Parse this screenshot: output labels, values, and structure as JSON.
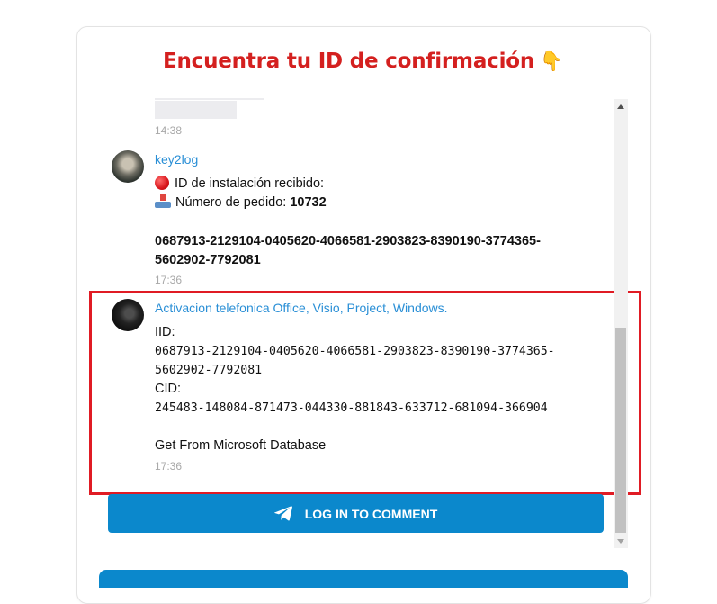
{
  "header": {
    "title": "Encuentra tu ID de confirmación",
    "title_emoji": "👇"
  },
  "messages": [
    {
      "time": "14:38"
    },
    {
      "author": "key2log",
      "line1": "ID de instalación recibido:",
      "line2_label": "Número de pedido:",
      "line2_value": "10732",
      "code_line1": "0687913-2129104-0405620-4066581-2903823-8390190-3774365-",
      "code_line2": "5602902-7792081",
      "time": "17:36"
    },
    {
      "author": "Activacion telefonica Office, Visio, Project, Windows.",
      "iid_label": "IID:",
      "iid_line1": "0687913-2129104-0405620-4066581-2903823-8390190-3774365-",
      "iid_line2": "5602902-7792081",
      "cid_label": "CID:",
      "cid_value": "245483-148084-871473-044330-881843-633712-681094-366904",
      "footer": "Get From Microsoft Database",
      "time": "17:36"
    }
  ],
  "actions": {
    "login_label": "LOG IN TO COMMENT"
  },
  "colors": {
    "title": "#d4201f",
    "accent": "#0b88cc",
    "author": "#2a8fd6",
    "highlight": "#e01b24"
  }
}
